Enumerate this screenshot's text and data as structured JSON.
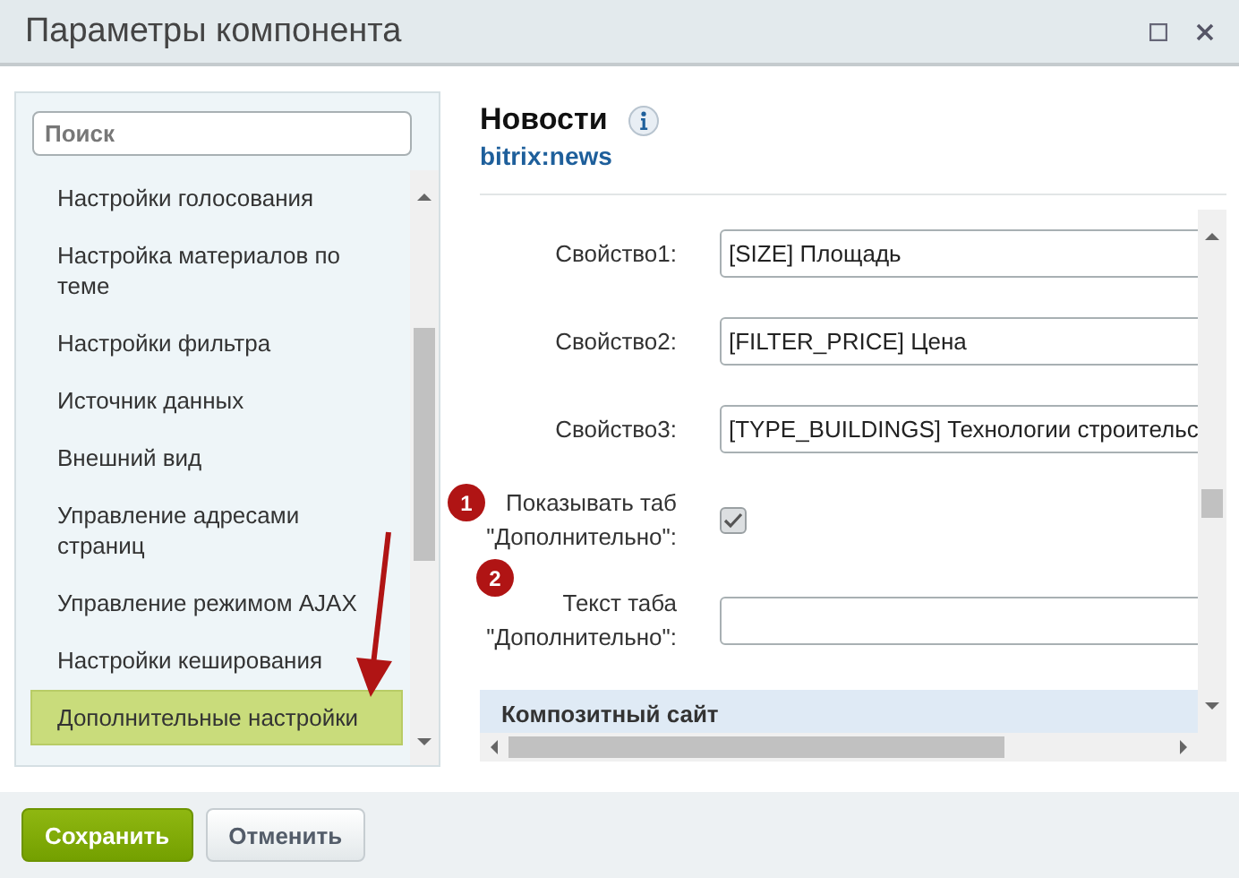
{
  "window": {
    "title": "Параметры компонента"
  },
  "sidebar": {
    "search": {
      "placeholder": "Поиск"
    },
    "items": [
      {
        "label": "Настройки голосования",
        "selected": false
      },
      {
        "label": "Настройка материалов по теме",
        "selected": false
      },
      {
        "label": "Настройки фильтра",
        "selected": false
      },
      {
        "label": "Источник данных",
        "selected": false
      },
      {
        "label": "Внешний вид",
        "selected": false
      },
      {
        "label": "Управление адресами страниц",
        "selected": false
      },
      {
        "label": "Управление режимом AJAX",
        "selected": false
      },
      {
        "label": "Настройки кеширования",
        "selected": false
      },
      {
        "label": "Дополнительные настройки",
        "selected": true
      }
    ]
  },
  "component": {
    "name": "Новости",
    "code": "bitrix:news"
  },
  "fields": [
    {
      "kind": "select",
      "label": "Свойство1:",
      "value": "[SIZE] Площадь"
    },
    {
      "kind": "select",
      "label": "Свойство2:",
      "value": "[FILTER_PRICE] Цена"
    },
    {
      "kind": "select",
      "label": "Свойство3:",
      "value": "[TYPE_BUILDINGS] Технологии строительс"
    },
    {
      "kind": "checkbox",
      "label": "Показывать таб \"Дополнительно\":",
      "checked": true,
      "marker": "1"
    },
    {
      "kind": "text",
      "label": "Текст таба \"Дополнительно\":",
      "marker": "2"
    }
  ],
  "section": {
    "title": "Композитный сайт"
  },
  "buttons": [
    {
      "label": "Сохранить",
      "kind": "primary"
    },
    {
      "label": "Отменить",
      "kind": "secondary"
    }
  ]
}
